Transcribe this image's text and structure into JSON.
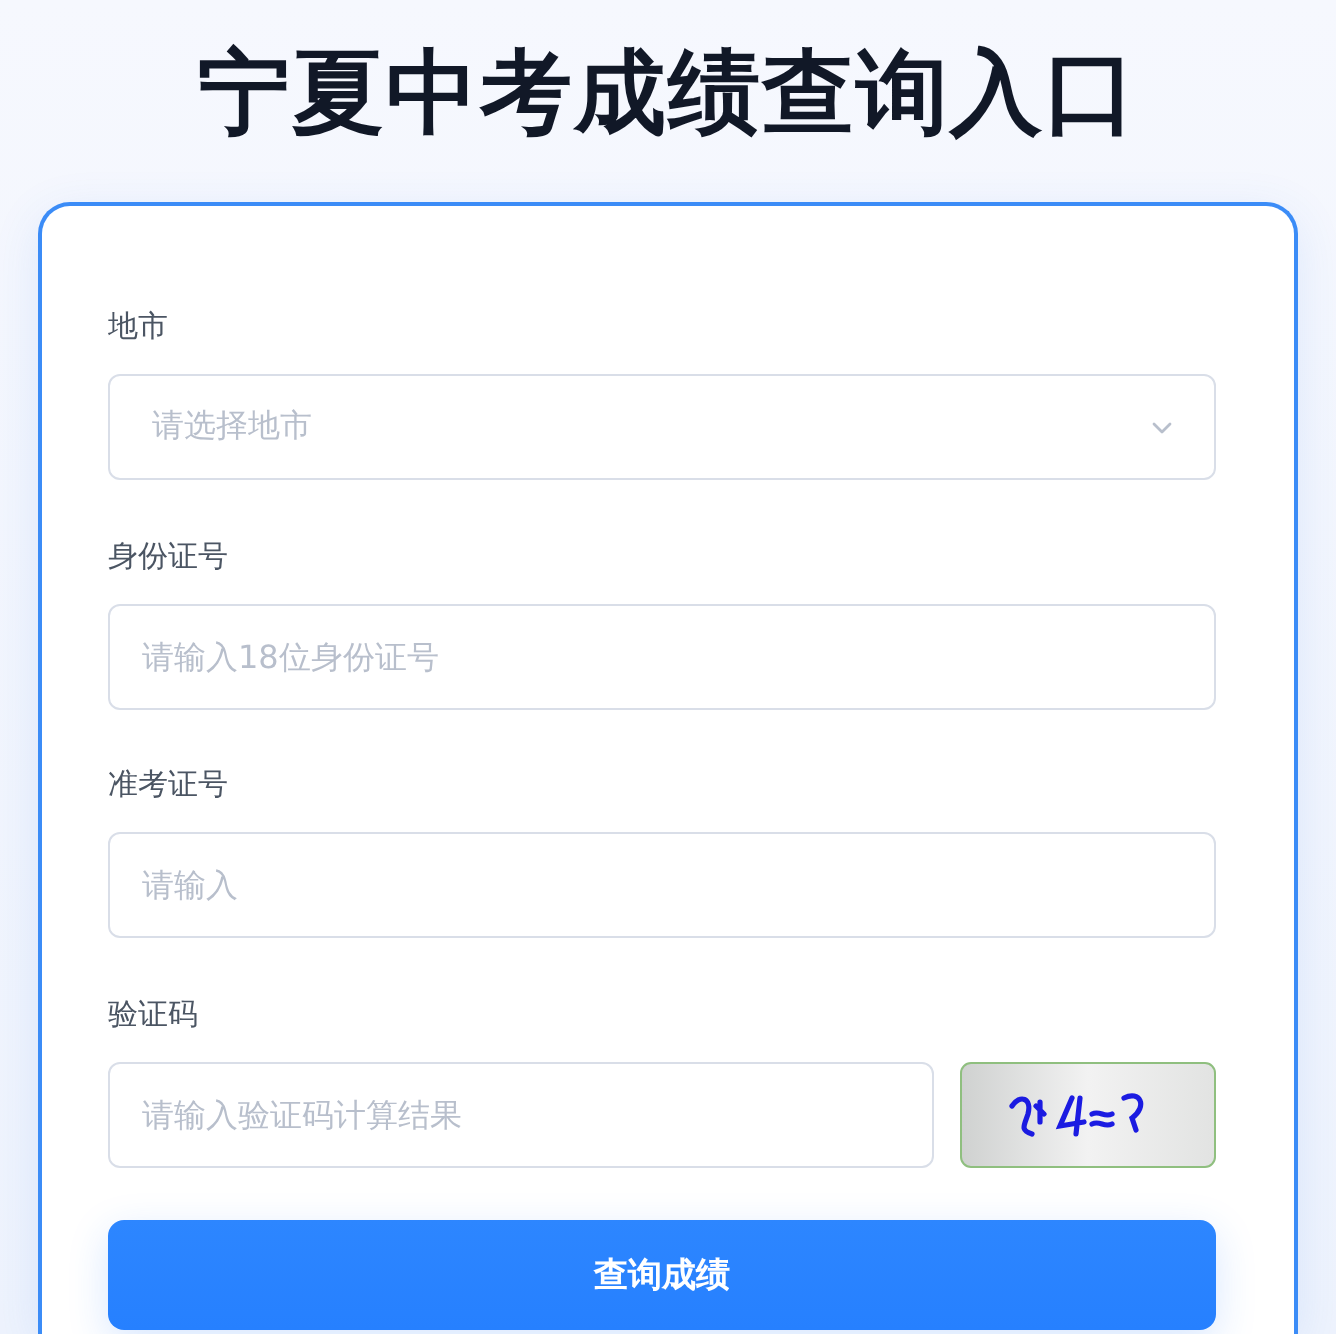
{
  "title": "宁夏中考成绩查询入口",
  "form": {
    "fields": [
      {
        "kind": "select",
        "label": "地市",
        "placeholder": "请选择地市"
      },
      {
        "kind": "text",
        "label": "身份证号",
        "placeholder": "请输入18位身份证号"
      },
      {
        "kind": "text",
        "label": "准考证号",
        "placeholder": "请输入"
      },
      {
        "kind": "captcha",
        "label": "验证码",
        "placeholder": "请输入验证码计算结果"
      }
    ],
    "submit": "查询成绩"
  }
}
